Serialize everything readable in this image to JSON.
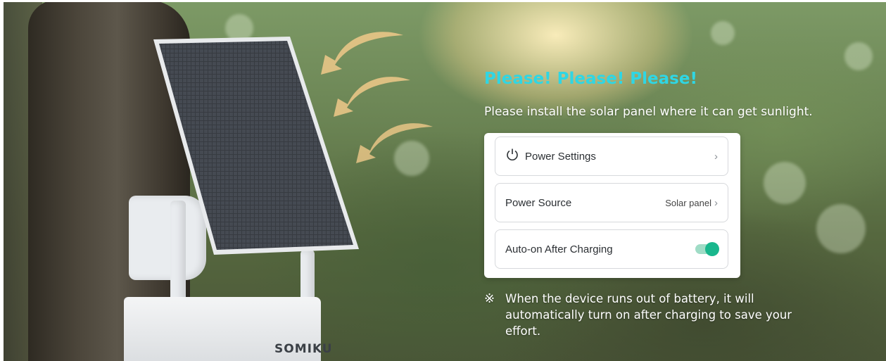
{
  "headline": "Please! Please! Please!",
  "subline": "Please install the solar panel where it can get sunlight.",
  "brand": "SOMIKU",
  "settings": {
    "power_settings": {
      "label": "Power Settings",
      "icon": "power-icon"
    },
    "power_source": {
      "label": "Power Source",
      "value": "Solar panel"
    },
    "auto_on": {
      "label": "Auto-on After Charging",
      "enabled": true
    }
  },
  "note": {
    "mark": "※",
    "text": "When the device runs out of battery, it will automatically turn on after charging to save your effort."
  },
  "colors": {
    "headline": "#2fd6e4",
    "toggle_on": "#19b78d"
  }
}
